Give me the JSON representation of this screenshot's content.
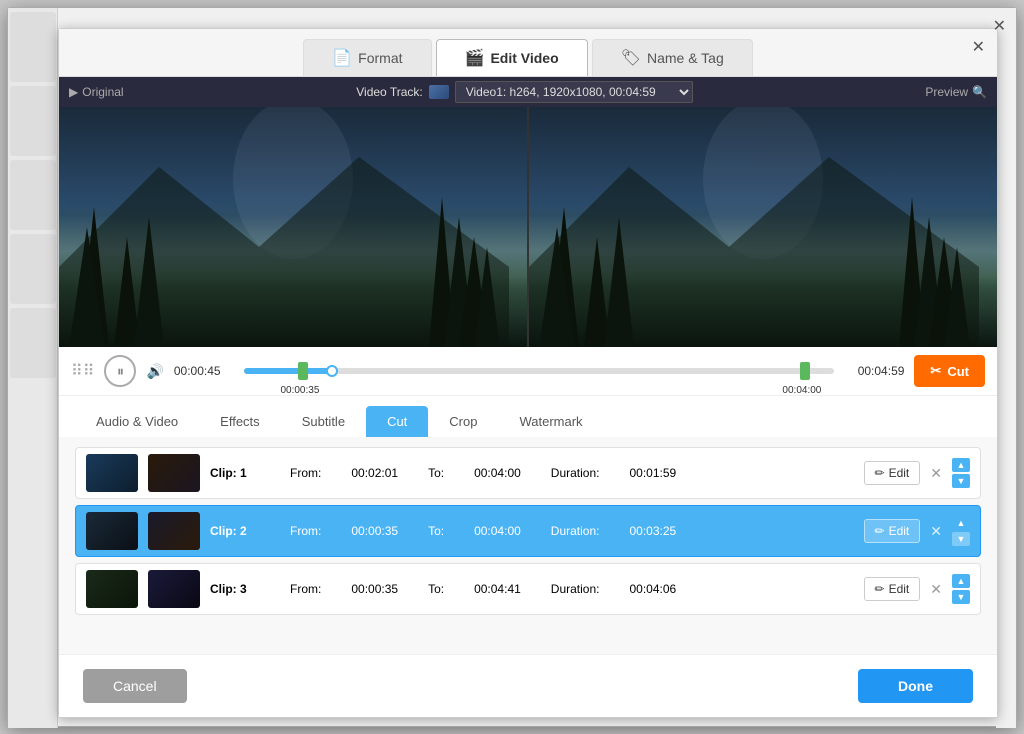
{
  "window": {
    "close_label": "✕"
  },
  "tabs": [
    {
      "id": "format",
      "label": "Format",
      "icon": "📄",
      "active": false
    },
    {
      "id": "edit-video",
      "label": "Edit Video",
      "icon": "🎬",
      "active": true
    },
    {
      "id": "name-tag",
      "label": "Name & Tag",
      "icon": "🏷",
      "active": false
    }
  ],
  "video_header": {
    "original_label": "Original",
    "video_track_label": "Video Track:",
    "track_value": "Video1: h264, 1920x1080, 00:04:59",
    "preview_label": "Preview",
    "play_icon": "▶"
  },
  "controls": {
    "time_start": "00:00:45",
    "time_end": "00:04:59",
    "handle_left_time": "00:00:35",
    "handle_right_time": "00:04:00",
    "cut_label": "Cut",
    "cut_icon": "✂"
  },
  "sub_tabs": [
    {
      "id": "audio-video",
      "label": "Audio & Video",
      "active": false
    },
    {
      "id": "effects",
      "label": "Effects",
      "active": false
    },
    {
      "id": "subtitle",
      "label": "Subtitle",
      "active": false
    },
    {
      "id": "cut",
      "label": "Cut",
      "active": true
    },
    {
      "id": "crop",
      "label": "Crop",
      "active": false
    },
    {
      "id": "watermark",
      "label": "Watermark",
      "active": false
    }
  ],
  "clips": [
    {
      "id": "clip-1",
      "name": "Clip: 1",
      "from_label": "From:",
      "from_time": "00:02:01",
      "to_label": "To:",
      "to_time": "00:04:00",
      "duration_label": "Duration:",
      "duration": "00:01:59",
      "edit_label": "Edit",
      "selected": false
    },
    {
      "id": "clip-2",
      "name": "Clip: 2",
      "from_label": "From:",
      "from_time": "00:00:35",
      "to_label": "To:",
      "to_time": "00:04:00",
      "duration_label": "Duration:",
      "duration": "00:03:25",
      "edit_label": "Edit",
      "selected": true
    },
    {
      "id": "clip-3",
      "name": "Clip: 3",
      "from_label": "From:",
      "from_time": "00:00:35",
      "to_label": "To:",
      "to_time": "00:04:41",
      "duration_label": "Duration:",
      "duration": "00:04:06",
      "edit_label": "Edit",
      "selected": false
    }
  ],
  "footer": {
    "cancel_label": "Cancel",
    "done_label": "Done"
  }
}
